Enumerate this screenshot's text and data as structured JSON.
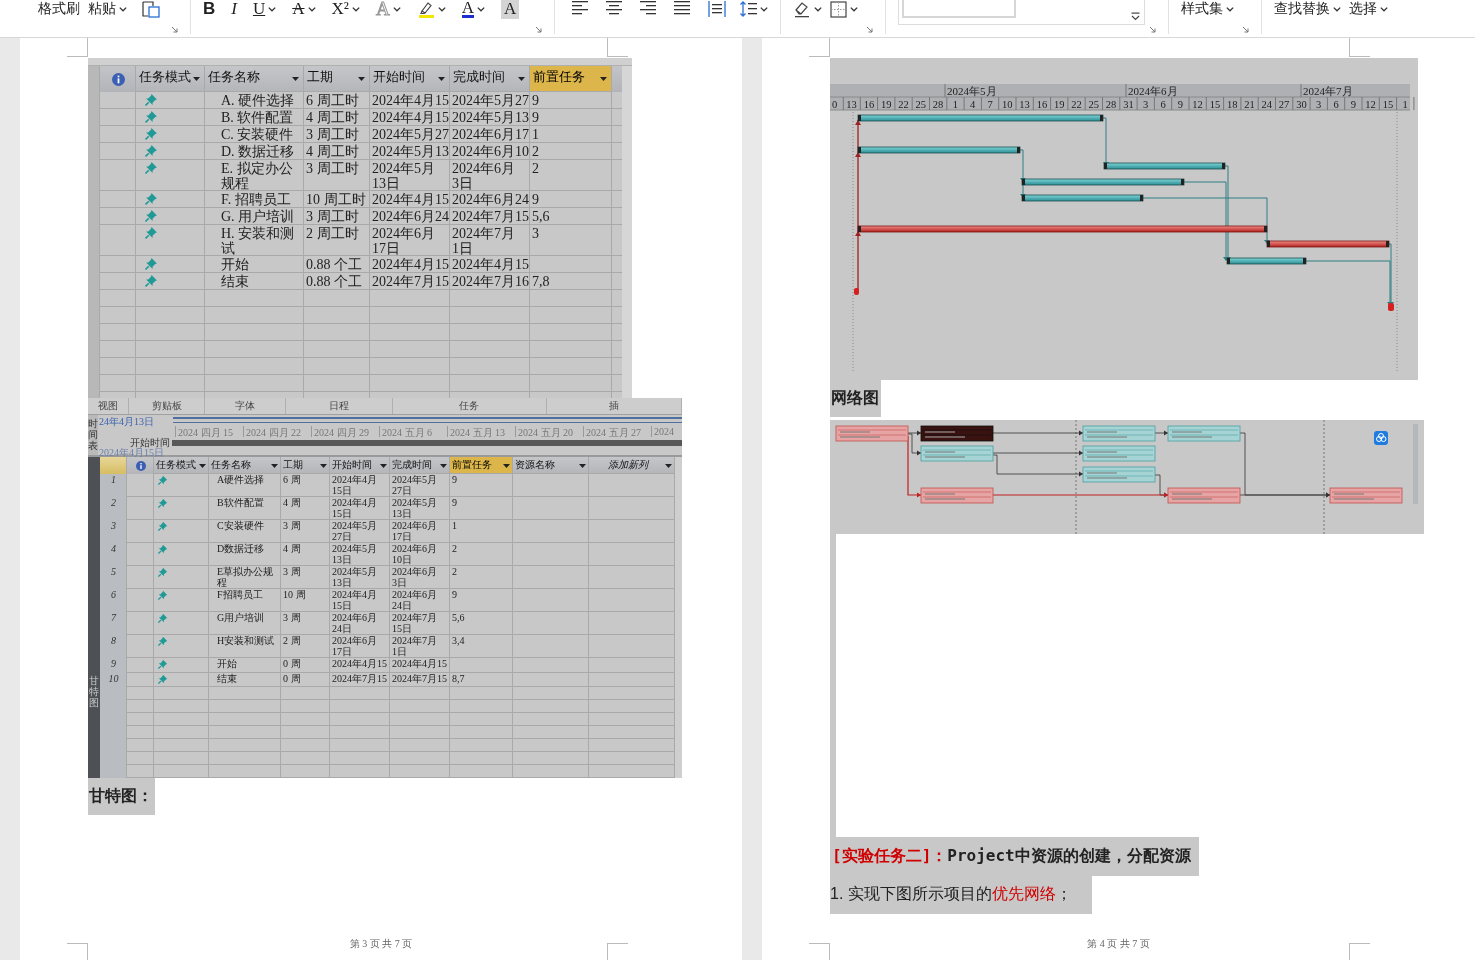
{
  "toolbar": {
    "left_buttons": [
      {
        "label": "格式刷",
        "dropdown": false
      },
      {
        "label": "粘贴",
        "dropdown": true
      }
    ],
    "font_buttons": [
      {
        "kind": "bold",
        "label": "B",
        "dropdown": false
      },
      {
        "kind": "italic",
        "label": "I",
        "dropdown": false
      },
      {
        "kind": "underline",
        "label": "U",
        "dropdown": true
      },
      {
        "kind": "strike",
        "label": "A",
        "dropdown": true
      },
      {
        "kind": "superscript",
        "label": "X²",
        "dropdown": true
      },
      {
        "kind": "outline",
        "label": "A",
        "dropdown": true
      },
      {
        "kind": "highlight",
        "dropdown": true
      },
      {
        "kind": "color",
        "label": "A",
        "dropdown": true
      },
      {
        "kind": "shaded",
        "label": "A",
        "dropdown": false
      }
    ],
    "right_buttons": [
      {
        "label": "样式集",
        "dropdown": true
      },
      {
        "label": "查找替换",
        "dropdown": true
      },
      {
        "label": "选择",
        "dropdown": true
      }
    ]
  },
  "left_page": {
    "project_table": {
      "columns": [
        {
          "label": "任务模式",
          "selected": false
        },
        {
          "label": "任务名称",
          "selected": false
        },
        {
          "label": "工期",
          "selected": false
        },
        {
          "label": "开始时间",
          "selected": false
        },
        {
          "label": "完成时间",
          "selected": false
        },
        {
          "label": "前置任务",
          "selected": true
        }
      ],
      "rows": [
        {
          "name": "A. 硬件选择",
          "duration": "6 周工时",
          "start": "2024年4月15",
          "finish": "2024年5月27",
          "predecessors": "9"
        },
        {
          "name": "B. 软件配置",
          "duration": "4 周工时",
          "start": "2024年4月15",
          "finish": "2024年5月13",
          "predecessors": "9"
        },
        {
          "name": "C. 安装硬件",
          "duration": "3 周工时",
          "start": "2024年5月27",
          "finish": "2024年6月17",
          "predecessors": "1"
        },
        {
          "name": "D. 数据迁移",
          "duration": "4 周工时",
          "start": "2024年5月13",
          "finish": "2024年6月10",
          "predecessors": "2"
        },
        {
          "name": [
            "E. 拟定办公",
            "规程"
          ],
          "duration": "3 周工时",
          "start": [
            "2024年5月",
            "13日"
          ],
          "finish": [
            "2024年6月",
            "3日"
          ],
          "predecessors": "2"
        },
        {
          "name": "F. 招聘员工",
          "duration": "10 周工时",
          "start": "2024年4月15",
          "finish": "2024年6月24",
          "predecessors": "9"
        },
        {
          "name": "G. 用户培训",
          "duration": "3 周工时",
          "start": "2024年6月24",
          "finish": "2024年7月15",
          "predecessors": "5,6"
        },
        {
          "name": [
            "H. 安装和测",
            "试"
          ],
          "duration": "2 周工时",
          "start": [
            "2024年6月",
            "17日"
          ],
          "finish": [
            "2024年7月",
            "1日"
          ],
          "predecessors": "3"
        },
        {
          "name": "开始",
          "duration": "0.88 个工",
          "start": "2024年4月15",
          "finish": "2024年4月15"
        },
        {
          "name": "结束",
          "duration": "0.88 个工",
          "start": "2024年7月15",
          "finish": "2024年7月16",
          "predecessors": "7,8"
        }
      ]
    },
    "project_window": {
      "ribbon_groups": [
        "视图",
        "剪贴板",
        "字体",
        "日程",
        "任务",
        "插"
      ],
      "timeline": {
        "side_label": "时间表",
        "date": "24年4月13日",
        "scale": [
          "2024 四月 15",
          "2024 四月 22",
          "2024 四月 29",
          "2024 五月 6",
          "2024 五月 13",
          "2024 五月 20",
          "2024 五月 27",
          "2024"
        ],
        "start_label": "开始时间",
        "start_date": "2024年4月15日"
      },
      "columns": [
        {
          "label": "任务模式",
          "kind": "field",
          "selected": false
        },
        {
          "label": "任务名称",
          "kind": "field",
          "selected": false
        },
        {
          "label": "工期",
          "kind": "field",
          "selected": false
        },
        {
          "label": "开始时间",
          "kind": "field",
          "selected": false
        },
        {
          "label": "完成时间",
          "kind": "field",
          "selected": false
        },
        {
          "label": "前置任务",
          "kind": "field",
          "selected": true
        },
        {
          "label": "资源名称",
          "kind": "field",
          "selected": false
        },
        {
          "label": "添加新列",
          "kind": "add",
          "selected": false
        }
      ],
      "rows": [
        {
          "id": "1",
          "name": "A硬件选择",
          "duration": "6 周",
          "start": [
            "2024年4月",
            "15日"
          ],
          "finish": [
            "2024年5月",
            "27日"
          ],
          "predecessors": "9"
        },
        {
          "id": "2",
          "name": "B软件配置",
          "duration": "4 周",
          "start": [
            "2024年4月",
            "15日"
          ],
          "finish": [
            "2024年5月",
            "13日"
          ],
          "predecessors": "9"
        },
        {
          "id": "3",
          "name": "C安装硬件",
          "duration": "3 周",
          "start": [
            "2024年5月",
            "27日"
          ],
          "finish": [
            "2024年6月",
            "17日"
          ],
          "predecessors": "1"
        },
        {
          "id": "4",
          "name": "D数据迁移",
          "duration": "4 周",
          "start": [
            "2024年5月",
            "13日"
          ],
          "finish": [
            "2024年6月",
            "10日"
          ],
          "predecessors": "2"
        },
        {
          "id": "5",
          "name": [
            "E草拟办公规",
            "程"
          ],
          "duration": "3 周",
          "start": [
            "2024年5月",
            "13日"
          ],
          "finish": [
            "2024年6月",
            "3日"
          ],
          "predecessors": "2"
        },
        {
          "id": "6",
          "name": "F招聘员工",
          "duration": "10 周",
          "start": [
            "2024年4月",
            "15日"
          ],
          "finish": [
            "2024年6月",
            "24日"
          ],
          "predecessors": "9"
        },
        {
          "id": "7",
          "name": "G用户培训",
          "duration": "3 周",
          "start": [
            "2024年6月",
            "24日"
          ],
          "finish": [
            "2024年7月",
            "15日"
          ],
          "predecessors": "5,6"
        },
        {
          "id": "8",
          "name": "H安装和测试",
          "duration": "2 周",
          "start": [
            "2024年6月",
            "17日"
          ],
          "finish": [
            "2024年7月",
            "1日"
          ],
          "predecessors": "3,4"
        },
        {
          "id": "9",
          "name": "开始",
          "duration": "0 周",
          "start": "2024年4月15",
          "finish": "2024年4月15"
        },
        {
          "id": "10",
          "name": "结束",
          "duration": "0 周",
          "start": "2024年7月15",
          "finish": "2024年7月15",
          "predecessors": "8,7"
        }
      ],
      "side_label": "甘特图"
    },
    "caption": "甘特图：",
    "footer": "第 3 页 共 7 页"
  },
  "right_page": {
    "gantt": {
      "months": [
        "2024年5月",
        "2024年6月",
        "2024年7月"
      ],
      "days": [
        "0",
        "13",
        "16",
        "19",
        "22",
        "25",
        "28",
        "1",
        "4",
        "7",
        "10",
        "13",
        "16",
        "19",
        "22",
        "25",
        "28",
        "31",
        "3",
        "6",
        "9",
        "12",
        "15",
        "18",
        "21",
        "24",
        "27",
        "30",
        "3",
        "6",
        "9",
        "12",
        "15",
        "1"
      ]
    },
    "caption": "网络图",
    "heading": [
      {
        "text": "[实验任务二]：",
        "highlight": true
      },
      {
        "text": "Project中资源的创建，分配资源",
        "highlight": false
      }
    ],
    "instruction": [
      {
        "text": "1. 实现下图所示项目的",
        "highlight": false
      },
      {
        "text": "优先网络",
        "highlight": true
      },
      {
        "text": "；",
        "highlight": false
      }
    ],
    "footer": "第 4 页 共 7 页"
  }
}
